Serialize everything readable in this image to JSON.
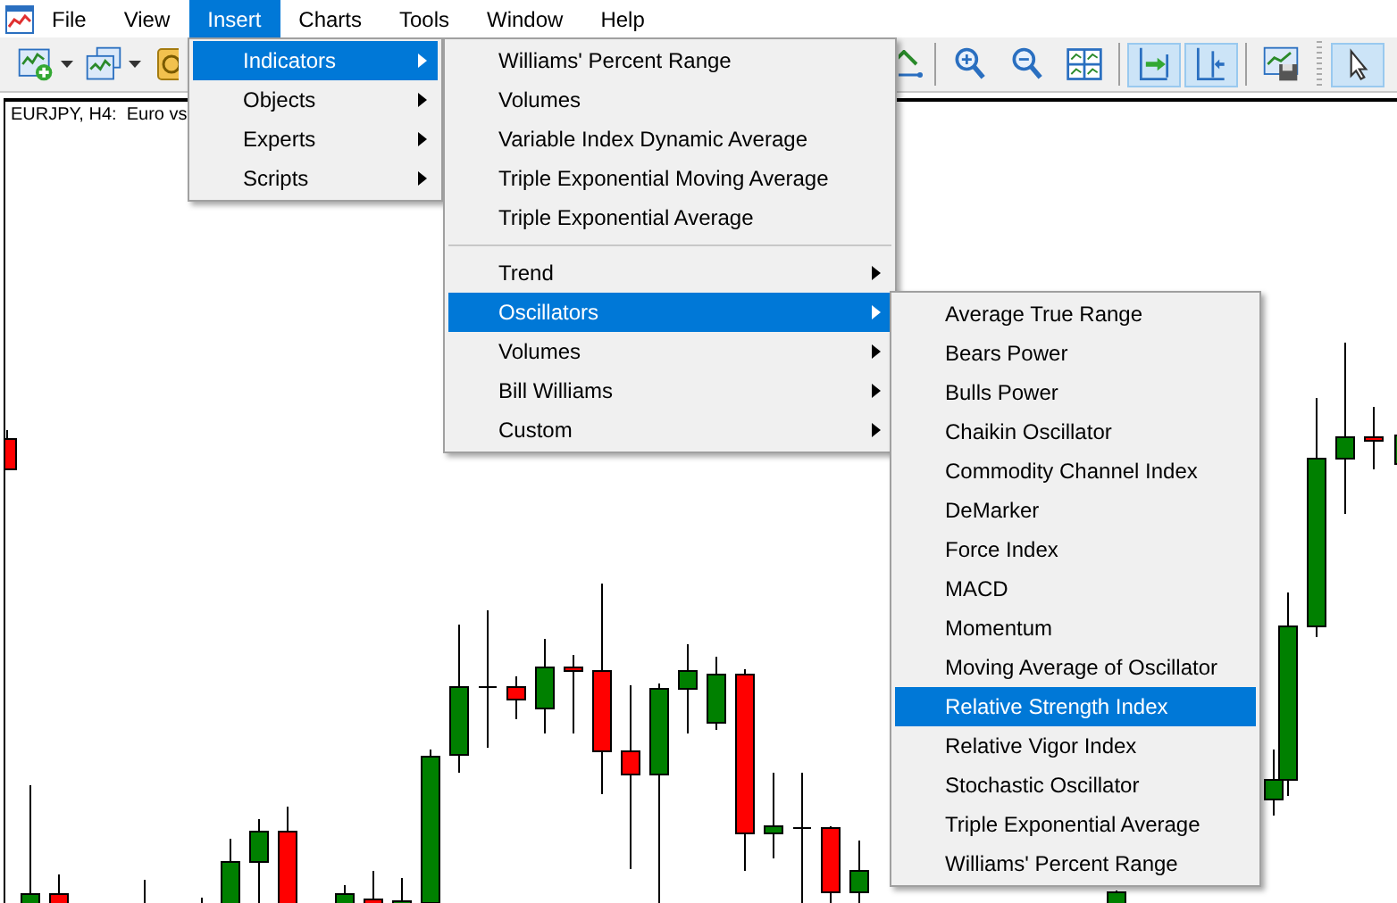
{
  "menu_bar": [
    {
      "label": "File",
      "selected": false
    },
    {
      "label": "View",
      "selected": false
    },
    {
      "label": "Insert",
      "selected": true
    },
    {
      "label": "Charts",
      "selected": false
    },
    {
      "label": "Tools",
      "selected": false
    },
    {
      "label": "Window",
      "selected": false
    },
    {
      "label": "Help",
      "selected": false
    }
  ],
  "toolbar": {
    "left": [
      {
        "kind": "new-chart",
        "dropdown": true,
        "selected": false
      },
      {
        "kind": "profiles",
        "dropdown": true,
        "selected": false
      },
      {
        "kind": "dollar",
        "dropdown": false,
        "selected": false
      }
    ],
    "right": [
      {
        "kind": "line-up",
        "dropdown": false,
        "selected": false
      },
      {
        "kind": "separator"
      },
      {
        "kind": "zoom-in",
        "dropdown": false,
        "selected": false
      },
      {
        "kind": "zoom-out",
        "dropdown": false,
        "selected": false
      },
      {
        "kind": "tile",
        "dropdown": false,
        "selected": false
      },
      {
        "kind": "separator"
      },
      {
        "kind": "autoscroll",
        "dropdown": false,
        "selected": true
      },
      {
        "kind": "shift",
        "dropdown": false,
        "selected": true
      },
      {
        "kind": "separator"
      },
      {
        "kind": "save-template",
        "dropdown": false,
        "selected": false
      },
      {
        "kind": "grip"
      },
      {
        "kind": "cursor",
        "dropdown": false,
        "selected": true
      }
    ]
  },
  "chart": {
    "title": "EURJPY, H4:  Euro vs"
  },
  "insert_menu": {
    "items": [
      {
        "kind": "item",
        "label": "Indicators",
        "submenu": true,
        "selected": true
      },
      {
        "kind": "item",
        "label": "Objects",
        "submenu": true,
        "selected": false
      },
      {
        "kind": "item",
        "label": "Experts",
        "submenu": true,
        "selected": false
      },
      {
        "kind": "item",
        "label": "Scripts",
        "submenu": true,
        "selected": false
      }
    ]
  },
  "indicators_menu": {
    "items": [
      {
        "kind": "item",
        "label": "Williams' Percent Range",
        "submenu": false,
        "selected": false
      },
      {
        "kind": "item",
        "label": "Volumes",
        "submenu": false,
        "selected": false
      },
      {
        "kind": "item",
        "label": "Variable Index Dynamic Average",
        "submenu": false,
        "selected": false
      },
      {
        "kind": "item",
        "label": "Triple Exponential Moving Average",
        "submenu": false,
        "selected": false
      },
      {
        "kind": "item",
        "label": "Triple Exponential Average",
        "submenu": false,
        "selected": false
      },
      {
        "kind": "separator"
      },
      {
        "kind": "item",
        "label": "Trend",
        "submenu": true,
        "selected": false
      },
      {
        "kind": "item",
        "label": "Oscillators",
        "submenu": true,
        "selected": true
      },
      {
        "kind": "item",
        "label": "Volumes",
        "submenu": true,
        "selected": false
      },
      {
        "kind": "item",
        "label": "Bill Williams",
        "submenu": true,
        "selected": false
      },
      {
        "kind": "item",
        "label": "Custom",
        "submenu": true,
        "selected": false
      }
    ]
  },
  "oscillators_menu": {
    "items": [
      {
        "kind": "item",
        "label": "Average True Range",
        "submenu": false,
        "selected": false
      },
      {
        "kind": "item",
        "label": "Bears Power",
        "submenu": false,
        "selected": false
      },
      {
        "kind": "item",
        "label": "Bulls Power",
        "submenu": false,
        "selected": false
      },
      {
        "kind": "item",
        "label": "Chaikin Oscillator",
        "submenu": false,
        "selected": false
      },
      {
        "kind": "item",
        "label": "Commodity Channel Index",
        "submenu": false,
        "selected": false
      },
      {
        "kind": "item",
        "label": "DeMarker",
        "submenu": false,
        "selected": false
      },
      {
        "kind": "item",
        "label": "Force Index",
        "submenu": false,
        "selected": false
      },
      {
        "kind": "item",
        "label": "MACD",
        "submenu": false,
        "selected": false
      },
      {
        "kind": "item",
        "label": "Momentum",
        "submenu": false,
        "selected": false
      },
      {
        "kind": "item",
        "label": "Moving Average of Oscillator",
        "submenu": false,
        "selected": false
      },
      {
        "kind": "item",
        "label": "Relative Strength Index",
        "submenu": false,
        "selected": true
      },
      {
        "kind": "item",
        "label": "Relative Vigor Index",
        "submenu": false,
        "selected": false
      },
      {
        "kind": "item",
        "label": "Stochastic Oscillator",
        "submenu": false,
        "selected": false
      },
      {
        "kind": "item",
        "label": "Triple Exponential Average",
        "submenu": false,
        "selected": false
      },
      {
        "kind": "item",
        "label": "Williams' Percent Range",
        "submenu": false,
        "selected": false
      }
    ]
  }
}
